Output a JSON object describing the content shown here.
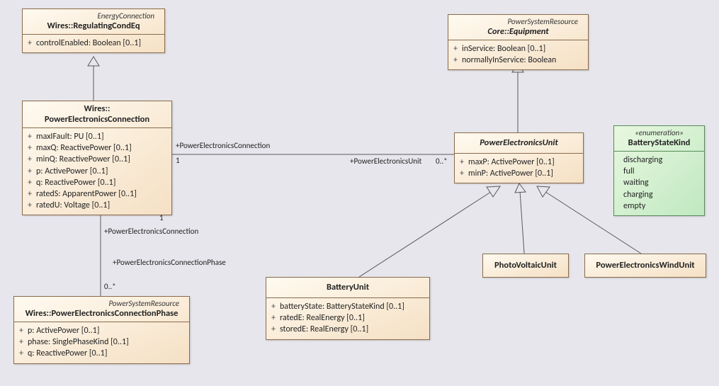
{
  "classes": {
    "regulatingCondEq": {
      "stereotype": "EnergyConnection",
      "name": "Wires::RegulatingCondEq",
      "attrs": [
        "controlEnabled: Boolean [0..1]"
      ]
    },
    "coreEquipment": {
      "stereotype": "PowerSystemResource",
      "name": "Core::Equipment",
      "attrs": [
        "inService: Boolean [0..1]",
        "normallyInService: Boolean"
      ]
    },
    "powerElecConn": {
      "name1": "Wires::",
      "name2": "PowerElectronicsConnection",
      "attrs": [
        "maxIFault: PU [0..1]",
        "maxQ: ReactivePower [0..1]",
        "minQ: ReactivePower [0..1]",
        "p: ActivePower [0..1]",
        "q: ReactivePower [0..1]",
        "ratedS: ApparentPower [0..1]",
        "ratedU: Voltage [0..1]"
      ]
    },
    "powerElecUnit": {
      "name": "PowerElectronicsUnit",
      "attrs": [
        "maxP: ActivePower [0..1]",
        "minP: ActivePower [0..1]"
      ]
    },
    "powerElecConnPhase": {
      "stereotype": "PowerSystemResource",
      "name": "Wires::PowerElectronicsConnectionPhase",
      "attrs": [
        "p: ActivePower [0..1]",
        "phase: SinglePhaseKind [0..1]",
        "q: ReactivePower [0..1]"
      ]
    },
    "batteryUnit": {
      "name": "BatteryUnit",
      "attrs": [
        "batteryState: BatteryStateKind [0..1]",
        "ratedE: RealEnergy [0..1]",
        "storedE: RealEnergy [0..1]"
      ]
    },
    "photoVoltaic": {
      "name": "PhotoVoltaicUnit"
    },
    "windUnit": {
      "name": "PowerElectronicsWindUnit"
    },
    "batteryStateKind": {
      "stereotype": "«enumeration»",
      "name": "BatteryStateKind",
      "attrs": [
        "discharging",
        "full",
        "waiting",
        "charging",
        "empty"
      ]
    }
  },
  "labels": {
    "assoc1_left": "+PowerElectronicsConnection",
    "assoc1_leftmult": "1",
    "assoc1_right": "+PowerElectronicsUnit",
    "assoc1_rightmult": "0..*",
    "assoc2_top": "+PowerElectronicsConnection",
    "assoc2_topmult": "1",
    "assoc2_bot": "+PowerElectronicsConnectionPhase",
    "assoc2_botmult": "0..*"
  }
}
